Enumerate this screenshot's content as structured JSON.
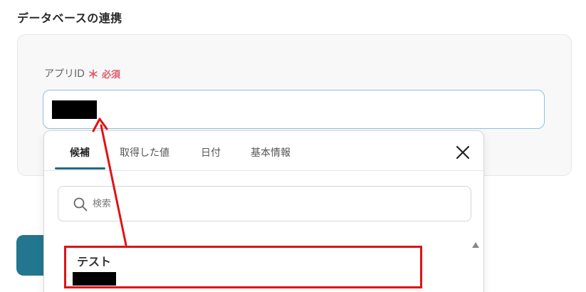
{
  "section": {
    "title": "データベースの連携"
  },
  "field": {
    "label": "アプリID",
    "required_mark": "＊",
    "required_text": "必須"
  },
  "dropdown": {
    "tabs": [
      {
        "label": "候補",
        "active": true
      },
      {
        "label": "取得した値",
        "active": false
      },
      {
        "label": "日付",
        "active": false
      },
      {
        "label": "基本情報",
        "active": false
      }
    ],
    "search": {
      "placeholder": "検索",
      "value": ""
    },
    "options": [
      {
        "label": "テスト"
      }
    ]
  },
  "colors": {
    "accent": "#1f6b86",
    "required": "#e05a67",
    "annotation": "#e01313",
    "primary_button": "#23768f"
  },
  "icons": [
    "close-icon",
    "search-icon",
    "scroll-up-icon",
    "annotation-arrow"
  ]
}
